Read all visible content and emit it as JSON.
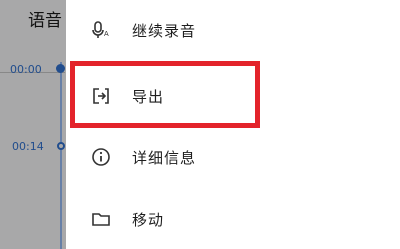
{
  "background": {
    "title": "语音",
    "time_start": "00:00",
    "time_second": "00:14"
  },
  "menu": {
    "items": [
      {
        "label": "继续录音",
        "icon": "mic-continue-icon"
      },
      {
        "label": "导出",
        "icon": "export-icon"
      },
      {
        "label": "详细信息",
        "icon": "info-icon"
      },
      {
        "label": "移动",
        "icon": "folder-icon"
      }
    ]
  },
  "colors": {
    "highlight": "#e3232b",
    "accent": "#2f6bc4"
  }
}
